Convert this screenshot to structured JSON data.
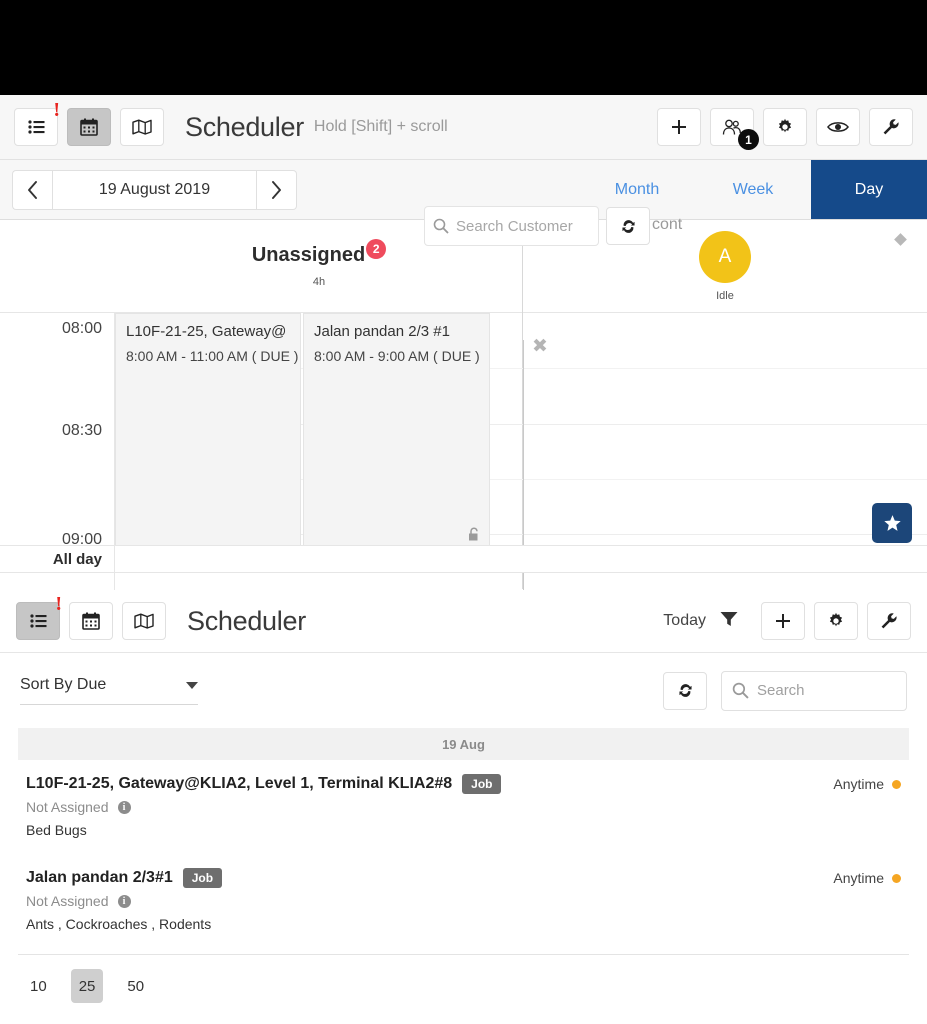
{
  "calendar_panel": {
    "toolbar": {
      "view_list_icon": "list-icon",
      "view_calendar_icon": "calendar-icon",
      "view_map_icon": "map-icon",
      "alert_marker": "!",
      "title": "Scheduler",
      "hint": "Hold [Shift] + scroll",
      "search_placeholder": "Search Customer",
      "overlap_text": "cont",
      "refresh_icon": "refresh-icon",
      "add_icon": "plus-icon",
      "team_icon": "team-icon",
      "team_badge": "1",
      "settings_icon": "gear-icon",
      "eye_icon": "eye-icon",
      "wrench_icon": "wrench-icon"
    },
    "datebar": {
      "prev_label": "‹",
      "next_label": "›",
      "current_date": "19 August 2019",
      "views": [
        {
          "label": "Month",
          "active": false
        },
        {
          "label": "Week",
          "active": false
        },
        {
          "label": "Day",
          "active": true
        }
      ]
    },
    "columns": {
      "unassigned": {
        "title": "Unassigned",
        "badge": "2",
        "hours": "4h",
        "diamond_icon": "diamond-icon",
        "close_icon": "✖"
      },
      "resource": {
        "avatar_initial": "A",
        "status": "Idle",
        "diamond_icon": "diamond-icon"
      }
    },
    "grid": {
      "all_day_label": "All day",
      "time_labels": [
        "08:00",
        "08:30",
        "09:00"
      ],
      "events": [
        {
          "title": "L10F-21-25, Gateway@",
          "time": "8:00 AM - 11:00 AM ( DUE )"
        },
        {
          "title": "Jalan pandan 2/3 #1",
          "time": "8:00 AM - 9:00 AM ( DUE )",
          "lock_icon": "unlock-icon"
        }
      ]
    },
    "star_button": {
      "icon": "star-icon"
    }
  },
  "list_panel": {
    "toolbar": {
      "view_list_icon": "list-icon",
      "view_calendar_icon": "calendar-icon",
      "view_map_icon": "map-icon",
      "alert_marker": "!",
      "title": "Scheduler",
      "today_label": "Today",
      "filter_icon": "filter-icon",
      "add_icon": "plus-icon",
      "settings_icon": "gear-icon",
      "wrench_icon": "wrench-icon"
    },
    "controls": {
      "sort_label": "Sort By Due",
      "refresh_icon": "refresh-icon",
      "search_placeholder": "Search"
    },
    "group_header": "19 Aug",
    "jobs": [
      {
        "title": "L10F-21-25, Gateway@KLIA2, Level 1, Terminal KLIA2#8",
        "tag": "Job",
        "assignment": "Not Assigned",
        "description": "Bed Bugs",
        "schedule": "Anytime"
      },
      {
        "title": "Jalan pandan 2/3#1",
        "tag": "Job",
        "assignment": "Not Assigned",
        "description": "Ants , Cockroaches , Rodents",
        "schedule": "Anytime"
      }
    ],
    "pagination": [
      {
        "label": "10",
        "active": false
      },
      {
        "label": "25",
        "active": true
      },
      {
        "label": "50",
        "active": false
      }
    ]
  },
  "colors": {
    "active_tab": "#154a8a",
    "link": "#4a90e2",
    "badge_red": "#ef4b5d",
    "avatar_yellow": "#f2c318",
    "amber_dot": "#f5a623",
    "alert_red": "#e8241f"
  }
}
